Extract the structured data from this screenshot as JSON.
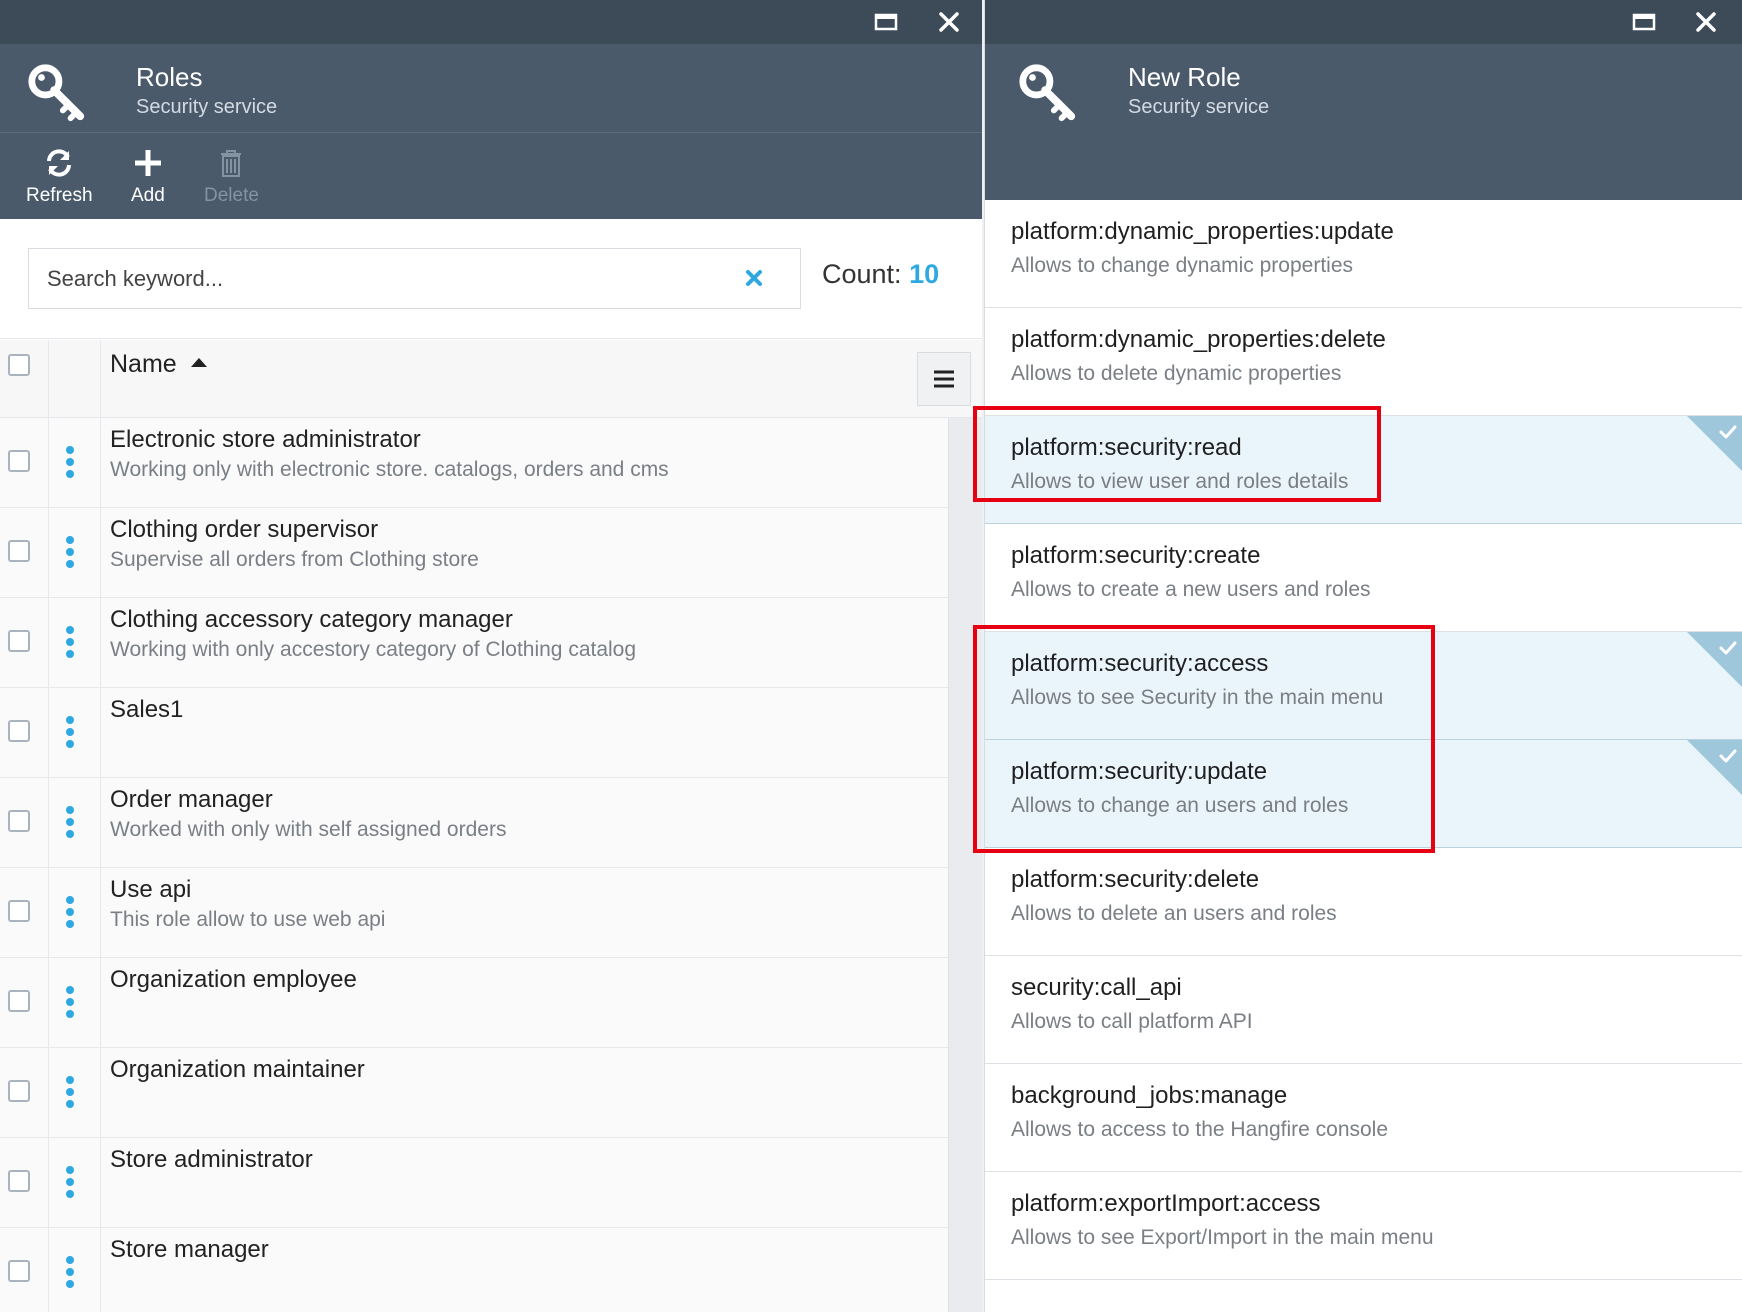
{
  "left_blade": {
    "title": "Roles",
    "subtitle": "Security service",
    "toolbar": {
      "refresh_label": "Refresh",
      "add_label": "Add",
      "delete_label": "Delete"
    },
    "search": {
      "placeholder": "Search keyword..."
    },
    "count": {
      "label": "Count:",
      "value": "10"
    },
    "grid": {
      "name_header": "Name",
      "rows": [
        {
          "name": "Electronic store administrator",
          "description": "Working only with electronic store. catalogs, orders and cms"
        },
        {
          "name": "Clothing order supervisor",
          "description": "Supervise all orders from Clothing store"
        },
        {
          "name": "Clothing accessory category manager",
          "description": "Working with only accestory category of Clothing catalog"
        },
        {
          "name": "Sales1",
          "description": ""
        },
        {
          "name": "Order manager",
          "description": "Worked with only with self assigned orders"
        },
        {
          "name": "Use api",
          "description": "This role allow to use web api"
        },
        {
          "name": "Organization employee",
          "description": ""
        },
        {
          "name": "Organization maintainer",
          "description": ""
        },
        {
          "name": "Store administrator",
          "description": ""
        },
        {
          "name": "Store manager",
          "description": ""
        }
      ]
    }
  },
  "right_blade": {
    "title": "New Role",
    "subtitle": "Security service",
    "permissions": [
      {
        "name": "platform:dynamic_properties:update",
        "description": "Allows to change dynamic properties",
        "selected": false
      },
      {
        "name": "platform:dynamic_properties:delete",
        "description": "Allows to delete dynamic properties",
        "selected": false
      },
      {
        "name": "platform:security:read",
        "description": "Allows to view user and roles details",
        "selected": true
      },
      {
        "name": "platform:security:create",
        "description": "Allows to create a new users and roles",
        "selected": false
      },
      {
        "name": "platform:security:access",
        "description": "Allows to see Security in the main menu",
        "selected": true
      },
      {
        "name": "platform:security:update",
        "description": "Allows to change an users and roles",
        "selected": true
      },
      {
        "name": "platform:security:delete",
        "description": "Allows to delete an users and roles",
        "selected": false
      },
      {
        "name": "security:call_api",
        "description": "Allows to call platform API",
        "selected": false
      },
      {
        "name": "background_jobs:manage",
        "description": "Allows to access to the Hangfire console",
        "selected": false
      },
      {
        "name": "platform:exportImport:access",
        "description": "Allows to see Export/Import in the main menu",
        "selected": false
      }
    ]
  },
  "colors": {
    "header_bg": "#4a5a6b",
    "topbar_bg": "#3d4a58",
    "accent": "#2ea8e0",
    "selected_bg": "#eaf5fb",
    "highlight_box": "#e60012"
  },
  "icons": {
    "maximize": "maximize-icon",
    "close": "close-icon",
    "key": "key-icon",
    "refresh": "refresh-icon",
    "add": "plus-icon",
    "delete": "trash-icon",
    "clear": "clear-x-icon",
    "menu": "hamburger-menu-icon",
    "row_actions": "vertical-dots-icon",
    "selected": "check-icon"
  }
}
